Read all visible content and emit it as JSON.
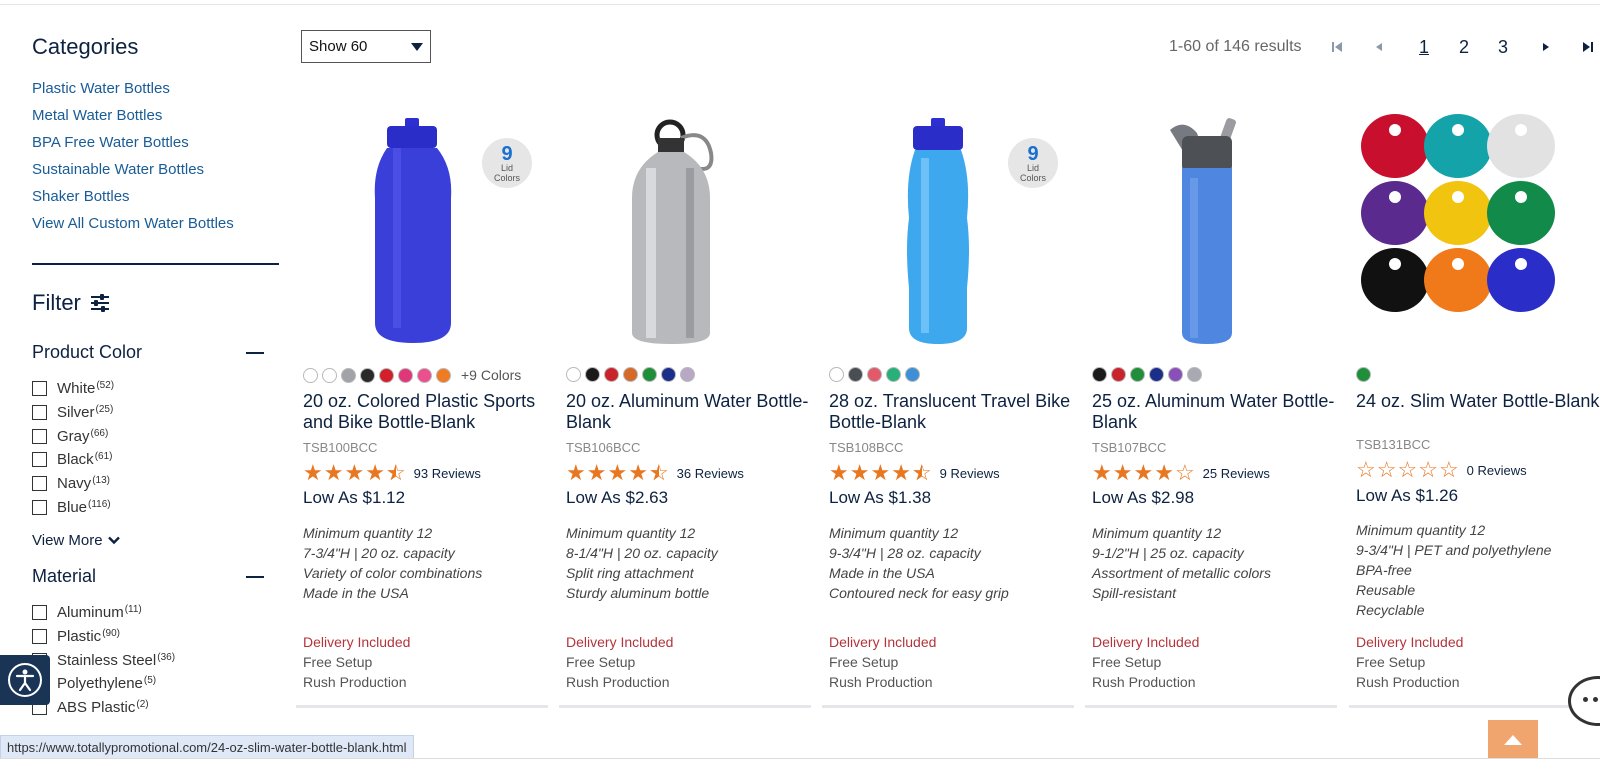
{
  "sidebar": {
    "categories_title": "Categories",
    "categories": [
      "Plastic Water Bottles",
      "Metal Water Bottles",
      "BPA Free Water Bottles",
      "Sustainable Water Bottles",
      "Shaker Bottles",
      "View All Custom Water Bottles"
    ],
    "filter_title": "Filter",
    "product_color": {
      "title": "Product Color",
      "options": [
        {
          "label": "White",
          "count": "(52)"
        },
        {
          "label": "Silver",
          "count": "(25)"
        },
        {
          "label": "Gray",
          "count": "(66)"
        },
        {
          "label": "Black",
          "count": "(61)"
        },
        {
          "label": "Navy",
          "count": "(13)"
        },
        {
          "label": "Blue",
          "count": "(116)"
        }
      ],
      "view_more": "View More"
    },
    "material": {
      "title": "Material",
      "options": [
        {
          "label": "Aluminum",
          "count": "(11)"
        },
        {
          "label": "Plastic",
          "count": "(90)"
        },
        {
          "label": "Stainless Steel",
          "count": "(36)"
        },
        {
          "label": "Polyethylene",
          "count": "(5)"
        },
        {
          "label": "ABS Plastic",
          "count": "(2)"
        }
      ]
    }
  },
  "toolbar": {
    "show_select": "Show 60",
    "results": "1-60 of 146 results",
    "pages": [
      "1",
      "2",
      "3"
    ],
    "current_page": "1"
  },
  "products": [
    {
      "name": "20 oz. Colored Plastic Sports and Bike Bottle-Blank",
      "sku": "TSB100BCC",
      "rating": 4.5,
      "reviews": "93 Reviews",
      "price": "Low As $1.12",
      "badge": {
        "number": "9",
        "text1": "Lid",
        "text2": "Colors"
      },
      "swatches": [
        "#ffffff",
        "#ffffff",
        "#a0a4a8",
        "#2a2a2a",
        "#d21f2b",
        "#e0367a",
        "#ec4f8e",
        "#f07c22"
      ],
      "more_colors": "+9 Colors",
      "features": [
        "Minimum quantity 12",
        "7-3/4\"H | 20 oz. capacity",
        "Variety of color combinations",
        "Made in the USA"
      ],
      "delivery": "Delivery Included",
      "setup": "Free Setup",
      "rush": "Rush Production"
    },
    {
      "name": "20 oz. Aluminum Water Bottle-Blank",
      "sku": "TSB106BCC",
      "rating": 4.5,
      "reviews": "36 Reviews",
      "price": "Low As $2.63",
      "swatches": [
        "#ffffff",
        "#1a1a1a",
        "#c9242b",
        "#d5692a",
        "#1f8f3a",
        "#1b2e8a",
        "#b7a9c6"
      ],
      "features": [
        "Minimum quantity 12",
        "8-1/4\"H | 20 oz. capacity",
        "Split ring attachment",
        "Sturdy aluminum bottle"
      ],
      "delivery": "Delivery Included",
      "setup": "Free Setup",
      "rush": "Rush Production"
    },
    {
      "name": "28 oz. Translucent Travel Bike Bottle-Blank",
      "sku": "TSB108BCC",
      "rating": 4.5,
      "reviews": "9 Reviews",
      "price": "Low As $1.38",
      "badge": {
        "number": "9",
        "text1": "Lid",
        "text2": "Colors"
      },
      "swatches": [
        "#ffffff",
        "#4a4d52",
        "#e05a6a",
        "#27b07a",
        "#3d8fd6"
      ],
      "features": [
        "Minimum quantity 12",
        "9-3/4\"H | 28 oz. capacity",
        "Made in the USA",
        "Contoured neck for easy grip"
      ],
      "delivery": "Delivery Included",
      "setup": "Free Setup",
      "rush": "Rush Production"
    },
    {
      "name": "25 oz. Aluminum Water Bottle-Blank",
      "sku": "TSB107BCC",
      "rating": 4,
      "reviews": "25 Reviews",
      "price": "Low As $2.98",
      "swatches": [
        "#1a1a1a",
        "#c9242b",
        "#1f8f3a",
        "#1b2e8a",
        "#8a4fb8",
        "#a9a9b4"
      ],
      "features": [
        "Minimum quantity 12",
        "9-1/2\"H | 25 oz. capacity",
        "Assortment of metallic colors",
        "Spill-resistant"
      ],
      "delivery": "Delivery Included",
      "setup": "Free Setup",
      "rush": "Rush Production"
    },
    {
      "name": "24 oz. Slim Water Bottle-Blank",
      "sku": "TSB131BCC",
      "rating": 0,
      "reviews": "0 Reviews",
      "price": "Low As $1.26",
      "swatches": [
        "#1f8f3a"
      ],
      "features": [
        "Minimum quantity 12",
        "9-3/4\"H | PET and polyethylene",
        "BPA-free",
        "Reusable",
        "Recyclable"
      ],
      "delivery": "Delivery Included",
      "setup": "Free Setup",
      "rush": "Rush Production"
    }
  ],
  "status_url": "https://www.totallypromotional.com/24-oz-slim-water-bottle-blank.html",
  "icons": [
    "filter-sliders-icon",
    "chevron-down-icon",
    "first-page-icon",
    "prev-page-icon",
    "next-page-icon",
    "last-page-icon",
    "accessibility-icon",
    "chat-icon",
    "scroll-top-icon"
  ],
  "colors": {
    "navy": "#0d2240",
    "link": "#1a5c96",
    "star": "#e87722",
    "delivery": "#b3343a"
  }
}
